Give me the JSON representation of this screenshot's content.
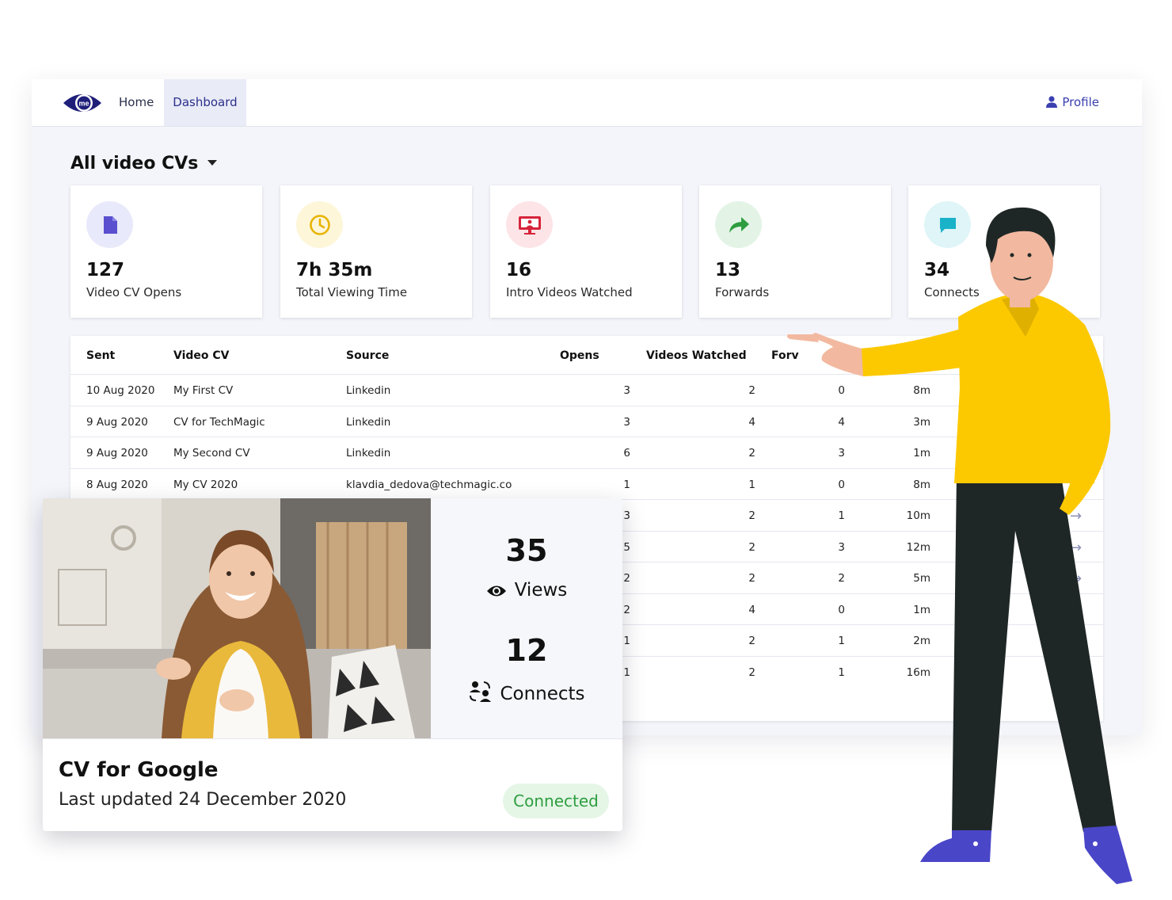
{
  "nav": {
    "home": "Home",
    "dashboard": "Dashboard",
    "profile": "Profile",
    "logo_text": "me"
  },
  "filter": {
    "label": "All video CVs"
  },
  "stats": [
    {
      "value": "127",
      "label": "Video CV Opens",
      "icon": "document-icon",
      "color": "#5a4fcf",
      "bg": "#e8e9fa"
    },
    {
      "value": "7h 35m",
      "label": "Total Viewing Time",
      "icon": "clock-icon",
      "color": "#e8b400",
      "bg": "#fdf6d9"
    },
    {
      "value": "16",
      "label": "Intro Videos Watched",
      "icon": "video-screen-icon",
      "color": "#d6243a",
      "bg": "#fce4e7"
    },
    {
      "value": "13",
      "label": "Forwards",
      "icon": "forward-arrow-icon",
      "color": "#2e9d3f",
      "bg": "#e3f4e6"
    },
    {
      "value": "34",
      "label": "Connects",
      "icon": "chat-icon",
      "color": "#19b2c9",
      "bg": "#dff5f8"
    }
  ],
  "table": {
    "headers": {
      "sent": "Sent",
      "video_cv": "Video CV",
      "source": "Source",
      "opens": "Opens",
      "videos_watched": "Videos Watched",
      "forwards": "Forv"
    },
    "rows": [
      {
        "sent": "10 Aug 2020",
        "cv": "My First CV",
        "source": "Linkedin",
        "opens": "3",
        "watched": "2",
        "forwards": "0",
        "time": "8m"
      },
      {
        "sent": "9 Aug 2020",
        "cv": "CV for TechMagic",
        "source": "Linkedin",
        "opens": "3",
        "watched": "4",
        "forwards": "4",
        "time": "3m"
      },
      {
        "sent": "9 Aug 2020",
        "cv": "My Second CV",
        "source": "Linkedin",
        "opens": "6",
        "watched": "2",
        "forwards": "3",
        "time": "1m"
      },
      {
        "sent": "8 Aug 2020",
        "cv": "My CV 2020",
        "source": "klavdia_dedova@techmagic.co",
        "opens": "1",
        "watched": "1",
        "forwards": "0",
        "time": "8m"
      },
      {
        "sent": "",
        "cv": "",
        "source": "",
        "opens": "3",
        "watched": "2",
        "forwards": "1",
        "time": "10m"
      },
      {
        "sent": "",
        "cv": "",
        "source": "",
        "opens": "5",
        "watched": "2",
        "forwards": "3",
        "time": "12m"
      },
      {
        "sent": "",
        "cv": "",
        "source": "",
        "opens": "2",
        "watched": "2",
        "forwards": "2",
        "time": "5m"
      },
      {
        "sent": "",
        "cv": "",
        "source": "",
        "opens": "2",
        "watched": "4",
        "forwards": "0",
        "time": "1m"
      },
      {
        "sent": "",
        "cv": "",
        "source": "",
        "opens": "1",
        "watched": "2",
        "forwards": "1",
        "time": "2m"
      },
      {
        "sent": "",
        "cv": "",
        "source": "",
        "opens": "1",
        "watched": "2",
        "forwards": "1",
        "time": "16m"
      }
    ]
  },
  "video_card": {
    "views_value": "35",
    "views_label": "Views",
    "connects_value": "12",
    "connects_label": "Connects",
    "title": "CV for Google",
    "updated": "Last updated 24 December 2020",
    "status": "Connected"
  }
}
